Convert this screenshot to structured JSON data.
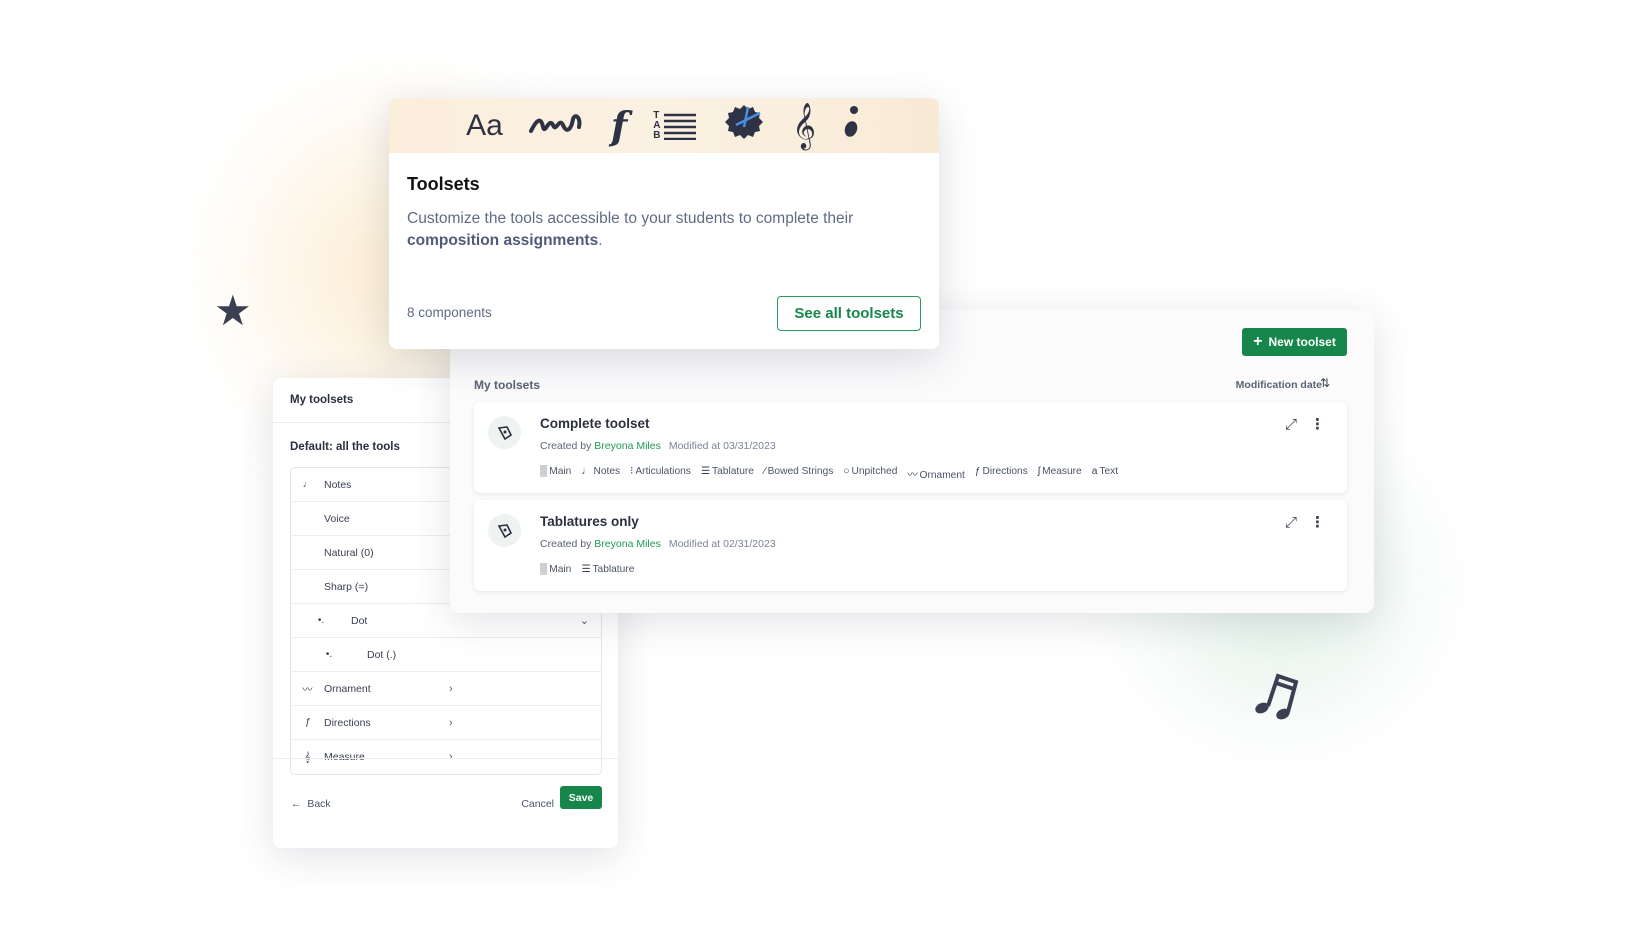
{
  "colors": {
    "accent": "#17864a",
    "link": "#1f9a55"
  },
  "intro_card": {
    "banner_icons": [
      "text-icon",
      "ornament-icon",
      "forte-icon",
      "tablature-icon",
      "unpitched-icon",
      "treble-clef-icon",
      "articulation-icon"
    ],
    "banner_text": {
      "text": "Aa",
      "tab": "TAB",
      "forte": "f"
    },
    "title": "Toolsets",
    "description": "Customize the tools accessible to your students to complete their",
    "description_bold": "composition assignments",
    "description_end": ".",
    "count": "8 components",
    "see_all_label": "See all toolsets"
  },
  "main": {
    "new_button_label": "New toolset",
    "section_label": "My toolsets",
    "sort_label": "Modification date",
    "toolsets": [
      {
        "name": "Complete toolset",
        "created_by_label": "Created by",
        "author": "Breyona Miles",
        "modified": "Modified at 03/31/2023",
        "tags": [
          {
            "icon": "main-icon",
            "label": "Main"
          },
          {
            "icon": "notes-icon",
            "label": "Notes"
          },
          {
            "icon": "articulations-icon",
            "label": "Articulations"
          },
          {
            "icon": "tablature-icon",
            "label": "Tablature"
          },
          {
            "icon": "bowed-strings-icon",
            "label": "Bowed Strings"
          },
          {
            "icon": "unpitched-icon",
            "label": "Unpitched"
          },
          {
            "icon": "ornament-icon",
            "label": "Ornament"
          },
          {
            "icon": "directions-icon",
            "label": "Directions"
          },
          {
            "icon": "measure-icon",
            "label": "Measure"
          },
          {
            "icon": "text-icon",
            "label": "Text"
          }
        ]
      },
      {
        "name": "Tablatures only",
        "created_by_label": "Created by",
        "author": "Breyona Miles",
        "modified": "Modified at 02/31/2023",
        "tags": [
          {
            "icon": "main-icon",
            "label": "Main"
          },
          {
            "icon": "tablature-icon",
            "label": "Tablature"
          }
        ]
      }
    ]
  },
  "editor": {
    "header": "My toolsets",
    "subtitle": "Default: all the tools",
    "rows": [
      {
        "label": "Notes",
        "icon": "quarter-note-icon"
      },
      {
        "label": "Voice"
      },
      {
        "label": "Natural (0)"
      },
      {
        "label": "Sharp (=)"
      },
      {
        "label": "Dot",
        "icon": "dot-icon",
        "expanded": true
      },
      {
        "label": "Dot (.)",
        "icon": "dot-icon"
      },
      {
        "label": "Ornament",
        "icon": "ornament-icon",
        "collapsed": true
      },
      {
        "label": "Directions",
        "icon": "directions-icon",
        "collapsed": true
      },
      {
        "label": "Measure",
        "icon": "measure-icon",
        "collapsed": true
      }
    ],
    "back_label": "Back",
    "cancel_label": "Cancel",
    "save_label": "Save"
  }
}
